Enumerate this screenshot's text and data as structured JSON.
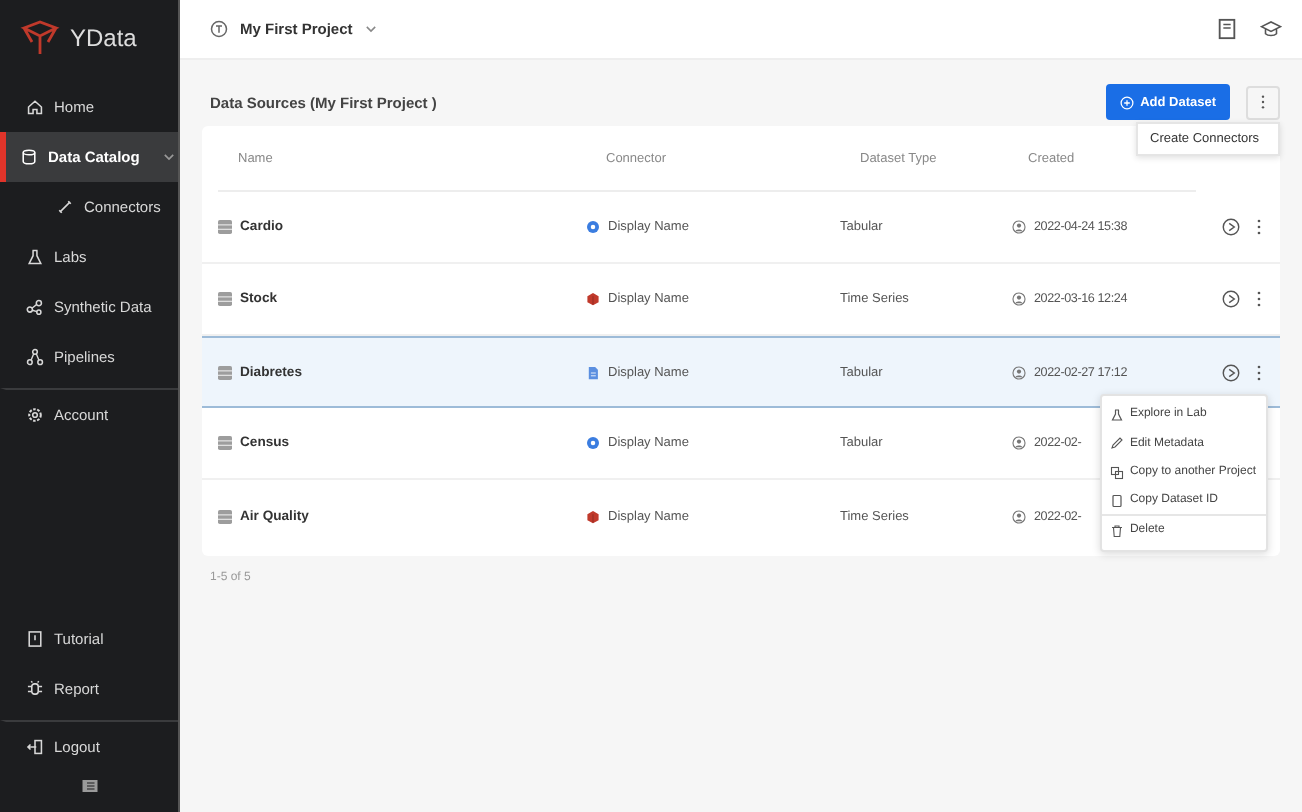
{
  "sidebar": {
    "logo": "YData",
    "items": [
      {
        "label": "Home",
        "selected": false
      },
      {
        "label": "Data Catalog",
        "selected": true,
        "expanded": true,
        "children": [
          {
            "label": "Connectors",
            "selected": false
          }
        ]
      },
      {
        "label": "Labs",
        "selected": false
      },
      {
        "label": "Synthetic Data",
        "selected": false
      },
      {
        "label": "Pipelines",
        "selected": false
      },
      {
        "label": "Account",
        "selected": false,
        "divider_before": true
      }
    ],
    "bottom_items": [
      {
        "label": "Tutorial"
      },
      {
        "label": "Report"
      },
      {
        "label": "Logout",
        "divider_before": true
      }
    ]
  },
  "header": {
    "project": "My First Project"
  },
  "page": {
    "title": "Data Sources (My First Project )",
    "add_button": "Add Dataset",
    "more_menu": [
      "Create Connectors"
    ]
  },
  "table": {
    "columns": [
      "Name",
      "Connector",
      "Dataset Type",
      "Created"
    ],
    "rows": [
      {
        "name": "Cardio",
        "connector": {
          "label": "Display Name",
          "kind": "gcs"
        },
        "type": "Tabular",
        "created": "2022-04-24  15:38",
        "selected": false
      },
      {
        "name": "Stock",
        "connector": {
          "label": "Display Name",
          "kind": "aws"
        },
        "type": "Time Series",
        "created": "2022-03-16  12:24",
        "selected": false
      },
      {
        "name": "Diabretes",
        "connector": {
          "label": "Display Name",
          "kind": "file"
        },
        "type": "Tabular",
        "created": "2022-02-27  17:12",
        "selected": true
      },
      {
        "name": "Census",
        "connector": {
          "label": "Display Name",
          "kind": "gcs"
        },
        "type": "Tabular",
        "created": "2022-02-",
        "selected": false
      },
      {
        "name": "Air Quality",
        "connector": {
          "label": "Display Name",
          "kind": "aws"
        },
        "type": "Time Series",
        "created": "2022-02-",
        "selected": false
      }
    ],
    "row_menu": [
      {
        "label": "Explore in Lab"
      },
      {
        "label": "Edit Metadata"
      },
      {
        "label": "Copy to another Project"
      },
      {
        "label": "Copy Dataset ID",
        "divider_after": true
      },
      {
        "label": "Delete"
      }
    ],
    "pager": "1-5 of 5"
  }
}
